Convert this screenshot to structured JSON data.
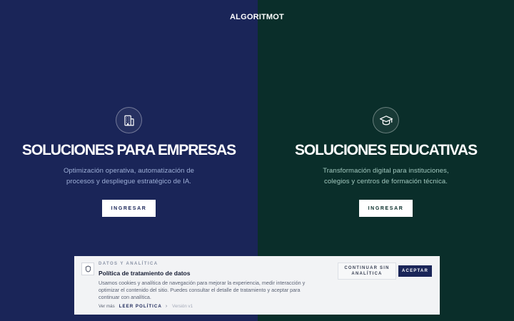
{
  "brand": {
    "name": "ALGORITMOT"
  },
  "panels": {
    "business": {
      "title": "SOLUCIONES PARA EMPRESAS",
      "description": "Optimización operativa, automatización de procesos y despliegue estratégico de IA.",
      "button_label": "INGRESAR",
      "icon": "building-icon",
      "background": "#1a2558"
    },
    "education": {
      "title": "SOLUCIONES EDUCATIVAS",
      "description": "Transformación digital para instituciones, colegios y centros de formación técnica.",
      "button_label": "INGRESAR",
      "icon": "graduation-cap-icon",
      "background": "#0a2e2a"
    }
  },
  "cookie_banner": {
    "eyebrow": "DATOS Y ANALÍTICA",
    "title": "Política de tratamiento de datos",
    "body": "Usamos cookies y analítica de navegación para mejorar la experiencia, medir interacción y optimizar el contenido del sitio. Puedes consultar el detalle de tratamiento y aceptar para continuar con analítica.",
    "see_more": "Ver más",
    "read_policy": "LEER POLÍTICA",
    "chevron": "›",
    "version": "Versión v1",
    "continue_without": "CONTINUAR SIN ANALÍTICA",
    "accept": "ACEPTAR",
    "icon": "shield-icon"
  }
}
